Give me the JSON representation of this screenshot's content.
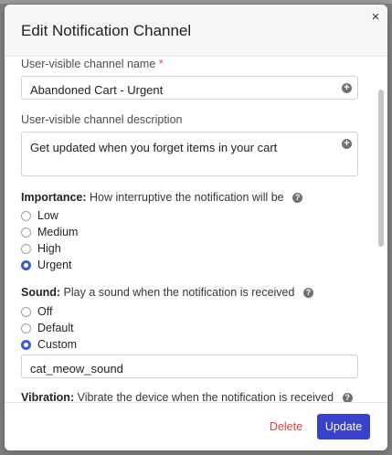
{
  "dialog": {
    "title": "Edit Notification Channel",
    "close_glyph": "×"
  },
  "form": {
    "name_label": "User-visible channel name",
    "required_mark": "*",
    "name_value": "Abandoned Cart - Urgent",
    "description_label": "User-visible channel description",
    "description_value": "Get updated when you forget items in your cart",
    "add_glyph": "+",
    "help_glyph": "?",
    "importance": {
      "label": "Importance:",
      "desc": "How interruptive the notification will be",
      "options": [
        "Low",
        "Medium",
        "High",
        "Urgent"
      ],
      "selected": "Urgent"
    },
    "sound": {
      "label": "Sound:",
      "desc": "Play a sound when the notification is received",
      "options": [
        "Off",
        "Default",
        "Custom"
      ],
      "selected": "Custom",
      "custom_value": "cat_meow_sound"
    },
    "vibration": {
      "label": "Vibration:",
      "desc": "Vibrate the device when the notification is received"
    }
  },
  "footer": {
    "delete_label": "Delete",
    "update_label": "Update"
  },
  "colors": {
    "accent": "#3a41cc",
    "danger": "#d0454a",
    "radio_selected": "#3b5bdb"
  }
}
